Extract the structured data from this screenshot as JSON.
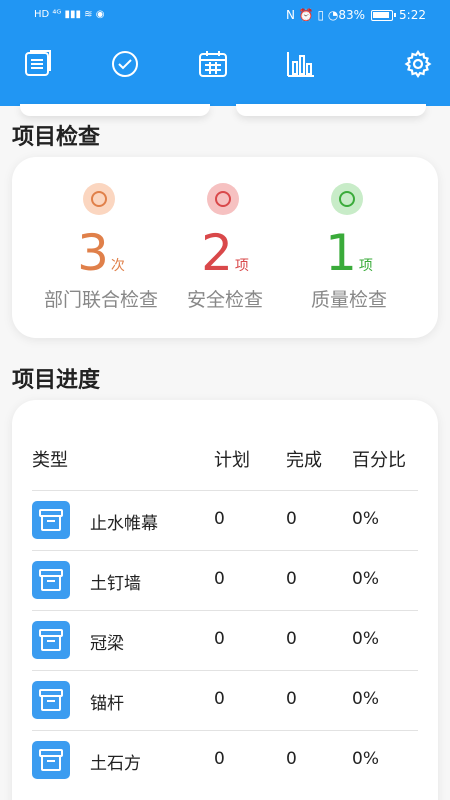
{
  "status": {
    "left": "HD ⁴ᴳ ▮▮▮ ≋ ◉",
    "right": "N ⏰ ▯ ◔83%",
    "time": "5:22"
  },
  "toolbar": {
    "items": [
      "list-icon",
      "check-circle-icon",
      "calendar-icon",
      "bar-chart-icon",
      "gear-icon"
    ]
  },
  "inspection": {
    "title": "项目检查",
    "items": [
      {
        "count": "3",
        "unit": "次",
        "label": "部门联合检查",
        "color": "#e0804a",
        "bg": "#fbd6c0"
      },
      {
        "count": "2",
        "unit": "项",
        "label": "安全检查",
        "color": "#d9484a",
        "bg": "#f6c1c1"
      },
      {
        "count": "1",
        "unit": "项",
        "label": "质量检查",
        "color": "#3aab3a",
        "bg": "#c8ecc8"
      }
    ]
  },
  "progress": {
    "title": "项目进度",
    "headers": {
      "type": "类型",
      "plan": "计划",
      "done": "完成",
      "percent": "百分比"
    },
    "rows": [
      {
        "name": "止水帷幕",
        "plan": "0",
        "done": "0",
        "percent": "0%"
      },
      {
        "name": "土钉墙",
        "plan": "0",
        "done": "0",
        "percent": "0%"
      },
      {
        "name": "冠梁",
        "plan": "0",
        "done": "0",
        "percent": "0%"
      },
      {
        "name": "锚杆",
        "plan": "0",
        "done": "0",
        "percent": "0%"
      },
      {
        "name": "土石方",
        "plan": "0",
        "done": "0",
        "percent": "0%"
      }
    ]
  }
}
